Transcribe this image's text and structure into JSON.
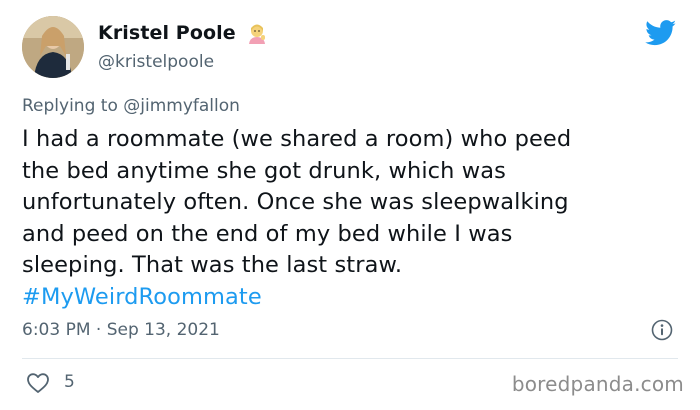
{
  "author": {
    "display_name": "Kristel Poole",
    "handle": "@kristelpoole",
    "emoji": "person-tipping-hand-emoji"
  },
  "reply": {
    "prefix": "Replying to ",
    "mention": "@jimmyfallon"
  },
  "tweet": {
    "lines": [
      "I had a roommate (we shared a room) who peed",
      "the bed anytime she got drunk, which was",
      "unfortunately often. Once she was sleepwalking",
      "and peed on the end of my bed while I was",
      "sleeping. That was the last straw."
    ],
    "hashtag": "#MyWeirdRoommate"
  },
  "timestamp": "6:03 PM · Sep 13, 2021",
  "likes": "5",
  "watermark": "boredpanda.com",
  "colors": {
    "link": "#1d9bf0",
    "muted": "#536471",
    "text": "#0f1419"
  }
}
